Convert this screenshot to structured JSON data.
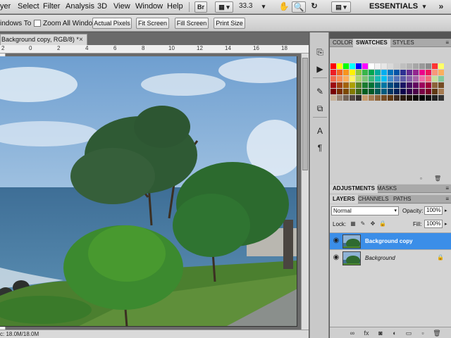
{
  "menubar": {
    "items": [
      "yer",
      "Select",
      "Filter",
      "Analysis",
      "3D",
      "View",
      "Window",
      "Help"
    ],
    "bridge_label": "Br",
    "zoom": "33.3",
    "workspace": "ESSENTIALS"
  },
  "options": {
    "windows_to_fit": "indows To Fit",
    "zoom_all_windows": "Zoom All Windows",
    "actual_pixels": "Actual Pixels",
    "fit_screen": "Fit Screen",
    "fill_screen": "Fill Screen",
    "print_size": "Print Size"
  },
  "document": {
    "tab_title": "Background copy, RGB/8) *",
    "close": "×",
    "ruler_ticks": [
      "2",
      "0",
      "2",
      "4",
      "6",
      "8",
      "10",
      "12",
      "14",
      "16",
      "18"
    ],
    "status": "c: 18.0M/18.0M"
  },
  "colors_panel": {
    "tabs": [
      "COLOR",
      "SWATCHES",
      "STYLES"
    ],
    "active_tab": "SWATCHES"
  },
  "adjust_panel": {
    "tabs": [
      "ADJUSTMENTS",
      "MASKS"
    ]
  },
  "layers_panel": {
    "tabs": [
      "LAYERS",
      "CHANNELS",
      "PATHS"
    ],
    "blend_mode": "Normal",
    "opacity_label": "Opacity:",
    "opacity": "100%",
    "lock_label": "Lock:",
    "fill_label": "Fill:",
    "fill": "100%",
    "layers": [
      {
        "name": "Background copy",
        "selected": true
      },
      {
        "name": "Background",
        "selected": false
      }
    ]
  },
  "swatch_colors": [
    [
      "#ff0000",
      "#ffff00",
      "#00ff00",
      "#00ffff",
      "#0000ff",
      "#ff00ff",
      "#ffffff",
      "#f2f2f2",
      "#e6e6e6",
      "#d9d9d9",
      "#cccccc",
      "#bfbfbf",
      "#b3b3b3",
      "#a6a6a6",
      "#999999",
      "#8c8c8c",
      "#ff3333",
      "#ffff66"
    ],
    [
      "#ed1c24",
      "#f26522",
      "#f7941d",
      "#fff200",
      "#8dc63f",
      "#39b54a",
      "#00a651",
      "#00a99d",
      "#00aeef",
      "#0072bc",
      "#0054a6",
      "#2e3192",
      "#662d91",
      "#92278f",
      "#ec008c",
      "#ed145b",
      "#f7977a",
      "#fbaf5d"
    ],
    [
      "#f26c4f",
      "#f68e56",
      "#fbaf5c",
      "#fff467",
      "#acd373",
      "#7cc576",
      "#3bb878",
      "#1abbb4",
      "#00bff3",
      "#438ccb",
      "#5574b9",
      "#605ca8",
      "#8560a8",
      "#a864a8",
      "#f06ea9",
      "#f26d7d",
      "#c4df9b",
      "#82ca9c"
    ],
    [
      "#9e0b0f",
      "#a0410d",
      "#a36209",
      "#aba000",
      "#598527",
      "#1a7b30",
      "#007236",
      "#00746b",
      "#0076a3",
      "#004b80",
      "#003471",
      "#1b1464",
      "#440e62",
      "#630460",
      "#9e005d",
      "#9e0039",
      "#8c6239",
      "#754c24"
    ],
    [
      "#790000",
      "#7b2e00",
      "#7d4900",
      "#827b00",
      "#406618",
      "#005e20",
      "#005826",
      "#005952",
      "#005b7f",
      "#003663",
      "#002157",
      "#0d004c",
      "#32004b",
      "#4b0049",
      "#7b0046",
      "#7a0026",
      "#603913",
      "#a67c52"
    ],
    [
      "#c7b299",
      "#998675",
      "#736357",
      "#534741",
      "#362f2d",
      "#c69c6d",
      "#a67c52",
      "#8c6239",
      "#754c24",
      "#603913",
      "#3d2b1f",
      "#2b1a10",
      "#1c120b",
      "#0a0603",
      "#000000",
      "#111111",
      "#222222",
      "#333333"
    ]
  ]
}
